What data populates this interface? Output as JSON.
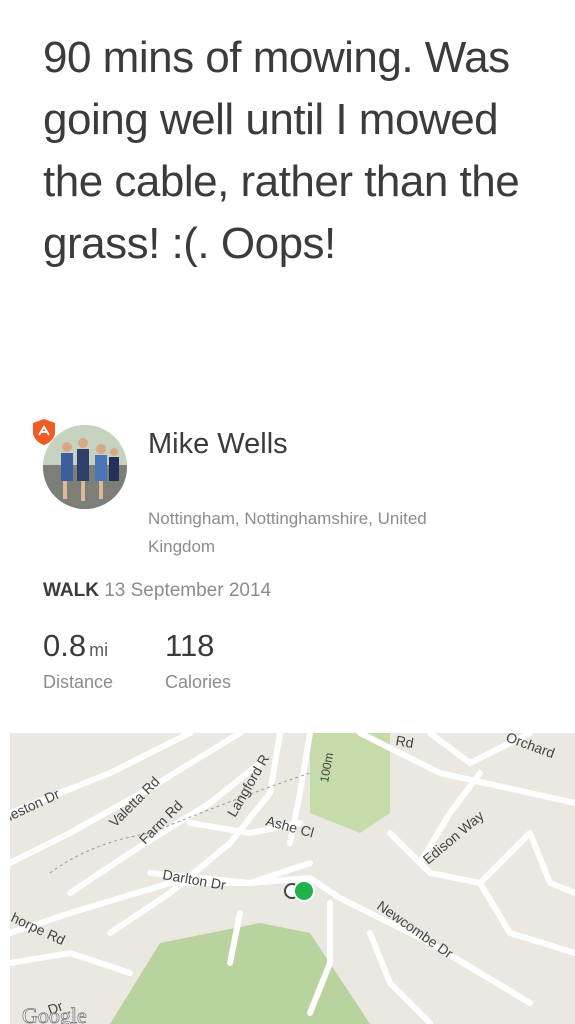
{
  "post": {
    "title": "90 mins of mowing. Was going well until I mowed the cable, rather than the grass! :(. Oops!"
  },
  "user": {
    "name": "Mike Wells",
    "location": "Nottingham, Nottinghamshire, United Kingdom"
  },
  "activity": {
    "type": "WALK",
    "date": "13 September 2014"
  },
  "stats": {
    "distance": {
      "value": "0.8",
      "unit": "mi",
      "label": "Distance"
    },
    "calories": {
      "value": "118",
      "label": "Calories"
    }
  },
  "map": {
    "streets": [
      "leston Dr",
      "Valetta Rd",
      "Farm Rd",
      "Langford R",
      "Ashe Cl",
      "Darlton Dr",
      "Newcombe Dr",
      "Edison Way",
      "Orchard",
      "Rd",
      "horpe Rd",
      "Dr"
    ],
    "scale_label": "100m",
    "attribution": "Google"
  },
  "colors": {
    "badge": "#f15a22",
    "marker": "#1fb34a",
    "park": "#b8d39e"
  }
}
